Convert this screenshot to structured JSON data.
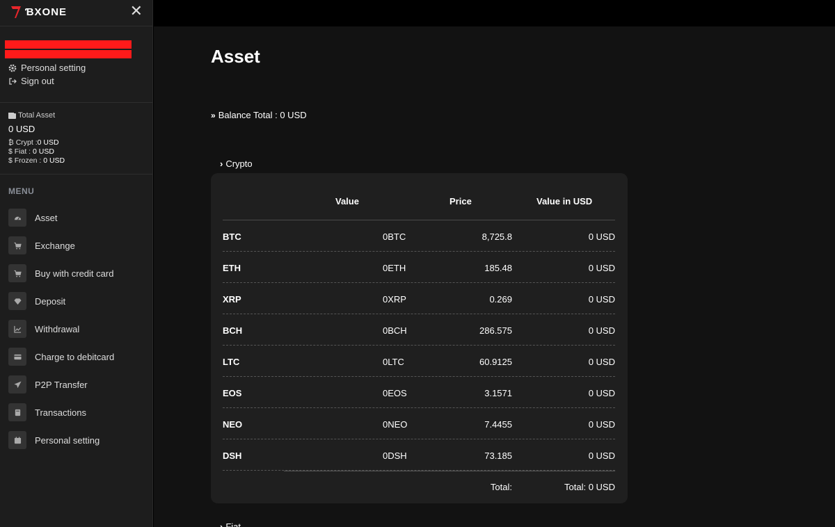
{
  "brand": {
    "name": "ƁXONE",
    "accent": "#e8262b"
  },
  "sidebar": {
    "user_links": [
      {
        "label": "Personal setting",
        "icon": "gear-icon"
      },
      {
        "label": "Sign out",
        "icon": "sign-out-icon"
      }
    ],
    "asset": {
      "title": "Total Asset",
      "total": "0 USD",
      "crypt_label": "Crypt :",
      "crypt_value": "0 USD",
      "fiat_label": "Fiat :",
      "fiat_value": "0 USD",
      "frozen_label": "Frozen :",
      "frozen_value": "0 USD"
    },
    "menu_label": "MENU",
    "menu": [
      {
        "label": "Asset",
        "icon": "dashboard-icon"
      },
      {
        "label": "Exchange",
        "icon": "cart-icon"
      },
      {
        "label": "Buy with credit card",
        "icon": "cart-icon"
      },
      {
        "label": "Deposit",
        "icon": "diamond-icon"
      },
      {
        "label": "Withdrawal",
        "icon": "chart-icon"
      },
      {
        "label": "Charge to debitcard",
        "icon": "credit-card-icon"
      },
      {
        "label": "P2P Transfer",
        "icon": "paper-plane-icon"
      },
      {
        "label": "Transactions",
        "icon": "book-icon"
      },
      {
        "label": "Personal setting",
        "icon": "calendar-icon"
      }
    ]
  },
  "main": {
    "title": "Asset",
    "balance": "Balance Total : 0 USD",
    "crypto_title": "Crypto",
    "fiat_title": "Fiat",
    "table": {
      "headers": [
        "Value",
        "Price",
        "Value in USD"
      ],
      "rows": [
        {
          "symbol": "BTC",
          "value": "0BTC",
          "price": "8,725.8",
          "usd": "0 USD"
        },
        {
          "symbol": "ETH",
          "value": "0ETH",
          "price": "185.48",
          "usd": "0 USD"
        },
        {
          "symbol": "XRP",
          "value": "0XRP",
          "price": "0.269",
          "usd": "0 USD"
        },
        {
          "symbol": "BCH",
          "value": "0BCH",
          "price": "286.575",
          "usd": "0 USD"
        },
        {
          "symbol": "LTC",
          "value": "0LTC",
          "price": "60.9125",
          "usd": "0 USD"
        },
        {
          "symbol": "EOS",
          "value": "0EOS",
          "price": "3.1571",
          "usd": "0 USD"
        },
        {
          "symbol": "NEO",
          "value": "0NEO",
          "price": "7.4455",
          "usd": "0 USD"
        },
        {
          "symbol": "DSH",
          "value": "0DSH",
          "price": "73.185",
          "usd": "0 USD"
        }
      ],
      "total_label": "Total:",
      "total_value": "Total: 0 USD"
    }
  }
}
